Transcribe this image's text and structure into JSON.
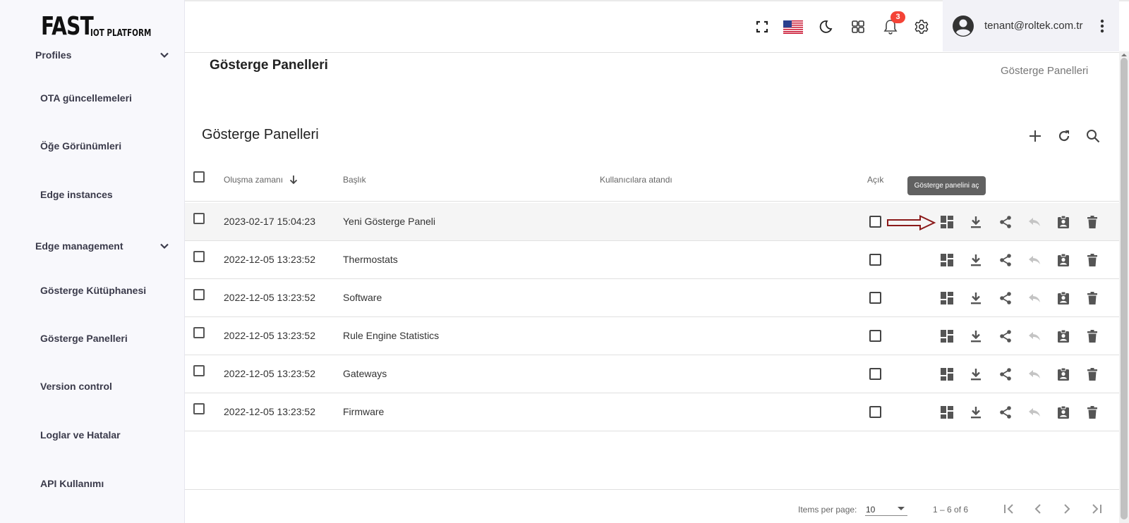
{
  "app": {
    "logo_big": "FAST",
    "logo_small": "IOT PLATFORM"
  },
  "sidebar": {
    "groups": [
      {
        "label": "Profiles"
      },
      {
        "label": "Edge management"
      }
    ],
    "items": [
      {
        "label": "OTA güncellemeleri"
      },
      {
        "label": "Öğe Görünümleri"
      },
      {
        "label": "Edge instances"
      },
      {
        "label": "Gösterge Kütüphanesi"
      },
      {
        "label": "Gösterge Panelleri"
      },
      {
        "label": "Version control"
      },
      {
        "label": "Loglar ve Hatalar"
      },
      {
        "label": "API Kullanımı"
      }
    ]
  },
  "topbar": {
    "notification_count": "3",
    "user_email": "tenant@roltek.com.tr",
    "icons": [
      "fullscreen-icon",
      "us-flag-icon",
      "dark-mode-icon",
      "apps-grid-icon",
      "notifications-bell-icon",
      "settings-gear-icon",
      "account-avatar-icon",
      "more-vert-icon"
    ]
  },
  "page": {
    "title": "Gösterge Panelleri",
    "breadcrumb": "Gösterge Panelleri"
  },
  "table": {
    "title": "Gösterge Panelleri",
    "columns": {
      "created": "Oluşma zamanı",
      "title": "Başlık",
      "assigned": "Kullanıcılara atandı",
      "public": "Açık"
    },
    "rows": [
      {
        "created": "2023-02-17 15:04:23",
        "title": "Yeni Gösterge Paneli",
        "assigned": "",
        "highlighted": true
      },
      {
        "created": "2022-12-05 13:23:52",
        "title": "Thermostats",
        "assigned": ""
      },
      {
        "created": "2022-12-05 13:23:52",
        "title": "Software",
        "assigned": ""
      },
      {
        "created": "2022-12-05 13:23:52",
        "title": "Rule Engine Statistics",
        "assigned": ""
      },
      {
        "created": "2022-12-05 13:23:52",
        "title": "Gateways",
        "assigned": ""
      },
      {
        "created": "2022-12-05 13:23:52",
        "title": "Firmware",
        "assigned": ""
      }
    ],
    "row_actions": [
      "open-dashboard-icon",
      "export-download-icon",
      "share-icon",
      "make-private-icon",
      "assign-customers-icon",
      "delete-icon"
    ],
    "tooltip": "Gösterge panelini aç"
  },
  "paginator": {
    "items_per_page_label": "Items per page:",
    "items_per_page": "10",
    "range": "1 – 6 of 6"
  },
  "colors": {
    "annotation_arrow": "#8b1a1a",
    "badge": "#f44336",
    "tooltip_bg": "#616161"
  }
}
